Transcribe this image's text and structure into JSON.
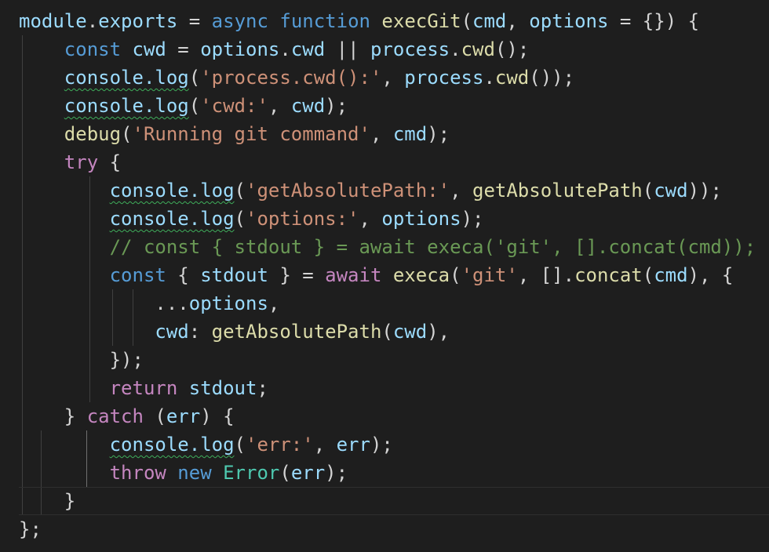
{
  "editor": {
    "language": "javascript",
    "theme": "dark",
    "lines": [
      [
        {
          "t": "module",
          "c": "var"
        },
        {
          "t": ".",
          "c": "pun"
        },
        {
          "t": "exports",
          "c": "var"
        },
        {
          "t": " = ",
          "c": "pun"
        },
        {
          "t": "async",
          "c": "kw"
        },
        {
          "t": " ",
          "c": "pun"
        },
        {
          "t": "function",
          "c": "kw"
        },
        {
          "t": " ",
          "c": "pun"
        },
        {
          "t": "execGit",
          "c": "fn"
        },
        {
          "t": "(",
          "c": "pun"
        },
        {
          "t": "cmd",
          "c": "var"
        },
        {
          "t": ", ",
          "c": "pun"
        },
        {
          "t": "options",
          "c": "var"
        },
        {
          "t": " = {}) {",
          "c": "pun"
        }
      ],
      [
        {
          "t": "    ",
          "c": "pun"
        },
        {
          "t": "const",
          "c": "kw"
        },
        {
          "t": " ",
          "c": "pun"
        },
        {
          "t": "cwd",
          "c": "var"
        },
        {
          "t": " = ",
          "c": "pun"
        },
        {
          "t": "options",
          "c": "var"
        },
        {
          "t": ".",
          "c": "pun"
        },
        {
          "t": "cwd",
          "c": "var"
        },
        {
          "t": " || ",
          "c": "pun"
        },
        {
          "t": "process",
          "c": "var"
        },
        {
          "t": ".",
          "c": "pun"
        },
        {
          "t": "cwd",
          "c": "fn"
        },
        {
          "t": "();",
          "c": "pun"
        }
      ],
      [
        {
          "t": "    ",
          "c": "pun"
        },
        {
          "t": "console.log",
          "c": "var",
          "warn": true
        },
        {
          "t": "(",
          "c": "pun"
        },
        {
          "t": "'process.cwd():'",
          "c": "str"
        },
        {
          "t": ", ",
          "c": "pun"
        },
        {
          "t": "process",
          "c": "var"
        },
        {
          "t": ".",
          "c": "pun"
        },
        {
          "t": "cwd",
          "c": "fn"
        },
        {
          "t": "());",
          "c": "pun"
        }
      ],
      [
        {
          "t": "    ",
          "c": "pun"
        },
        {
          "t": "console.log",
          "c": "var",
          "warn": true
        },
        {
          "t": "(",
          "c": "pun"
        },
        {
          "t": "'cwd:'",
          "c": "str"
        },
        {
          "t": ", ",
          "c": "pun"
        },
        {
          "t": "cwd",
          "c": "var"
        },
        {
          "t": ");",
          "c": "pun"
        }
      ],
      [
        {
          "t": "    ",
          "c": "pun"
        },
        {
          "t": "debug",
          "c": "fn"
        },
        {
          "t": "(",
          "c": "pun"
        },
        {
          "t": "'Running git command'",
          "c": "str"
        },
        {
          "t": ", ",
          "c": "pun"
        },
        {
          "t": "cmd",
          "c": "var"
        },
        {
          "t": ");",
          "c": "pun"
        }
      ],
      [
        {
          "t": "    ",
          "c": "pun"
        },
        {
          "t": "try",
          "c": "ctl"
        },
        {
          "t": " {",
          "c": "pun"
        }
      ],
      [
        {
          "t": "        ",
          "c": "pun"
        },
        {
          "t": "console.log",
          "c": "var",
          "warn": true
        },
        {
          "t": "(",
          "c": "pun"
        },
        {
          "t": "'getAbsolutePath:'",
          "c": "str"
        },
        {
          "t": ", ",
          "c": "pun"
        },
        {
          "t": "getAbsolutePath",
          "c": "fn"
        },
        {
          "t": "(",
          "c": "pun"
        },
        {
          "t": "cwd",
          "c": "var"
        },
        {
          "t": "));",
          "c": "pun"
        }
      ],
      [
        {
          "t": "        ",
          "c": "pun"
        },
        {
          "t": "console.log",
          "c": "var",
          "warn": true
        },
        {
          "t": "(",
          "c": "pun"
        },
        {
          "t": "'options:'",
          "c": "str"
        },
        {
          "t": ", ",
          "c": "pun"
        },
        {
          "t": "options",
          "c": "var"
        },
        {
          "t": ");",
          "c": "pun"
        }
      ],
      [
        {
          "t": "        ",
          "c": "pun"
        },
        {
          "t": "// const { stdout } = await execa('git', [].concat(cmd));",
          "c": "cmt"
        }
      ],
      [
        {
          "t": "        ",
          "c": "pun"
        },
        {
          "t": "const",
          "c": "kw"
        },
        {
          "t": " { ",
          "c": "pun"
        },
        {
          "t": "stdout",
          "c": "var"
        },
        {
          "t": " } = ",
          "c": "pun"
        },
        {
          "t": "await",
          "c": "ctl"
        },
        {
          "t": " ",
          "c": "pun"
        },
        {
          "t": "execa",
          "c": "fn"
        },
        {
          "t": "(",
          "c": "pun"
        },
        {
          "t": "'git'",
          "c": "str"
        },
        {
          "t": ", [].",
          "c": "pun"
        },
        {
          "t": "concat",
          "c": "fn"
        },
        {
          "t": "(",
          "c": "pun"
        },
        {
          "t": "cmd",
          "c": "var"
        },
        {
          "t": "), {",
          "c": "pun"
        }
      ],
      [
        {
          "t": "            ",
          "c": "pun"
        },
        {
          "t": "...",
          "c": "pun"
        },
        {
          "t": "options",
          "c": "var"
        },
        {
          "t": ",",
          "c": "pun"
        }
      ],
      [
        {
          "t": "            ",
          "c": "pun"
        },
        {
          "t": "cwd",
          "c": "var"
        },
        {
          "t": ": ",
          "c": "pun"
        },
        {
          "t": "getAbsolutePath",
          "c": "fn"
        },
        {
          "t": "(",
          "c": "pun"
        },
        {
          "t": "cwd",
          "c": "var"
        },
        {
          "t": "),",
          "c": "pun"
        }
      ],
      [
        {
          "t": "        ",
          "c": "pun"
        },
        {
          "t": "});",
          "c": "pun"
        }
      ],
      [
        {
          "t": "        ",
          "c": "pun"
        },
        {
          "t": "return",
          "c": "ctl"
        },
        {
          "t": " ",
          "c": "pun"
        },
        {
          "t": "stdout",
          "c": "var"
        },
        {
          "t": ";",
          "c": "pun"
        }
      ],
      [
        {
          "t": "    ",
          "c": "pun"
        },
        {
          "t": "} ",
          "c": "pun"
        },
        {
          "t": "catch",
          "c": "ctl"
        },
        {
          "t": " (",
          "c": "pun"
        },
        {
          "t": "err",
          "c": "var"
        },
        {
          "t": ") {",
          "c": "pun"
        }
      ],
      [
        {
          "t": "        ",
          "c": "pun"
        },
        {
          "t": "console.log",
          "c": "var",
          "warn": true
        },
        {
          "t": "(",
          "c": "pun"
        },
        {
          "t": "'err:'",
          "c": "str"
        },
        {
          "t": ", ",
          "c": "pun"
        },
        {
          "t": "err",
          "c": "var"
        },
        {
          "t": ");",
          "c": "pun"
        }
      ],
      [
        {
          "t": "        ",
          "c": "pun"
        },
        {
          "t": "throw",
          "c": "ctl"
        },
        {
          "t": " ",
          "c": "pun"
        },
        {
          "t": "new",
          "c": "kw"
        },
        {
          "t": " ",
          "c": "pun"
        },
        {
          "t": "Error",
          "c": "cls"
        },
        {
          "t": "(",
          "c": "pun"
        },
        {
          "t": "err",
          "c": "var"
        },
        {
          "t": ");",
          "c": "pun"
        }
      ],
      [
        {
          "t": "    ",
          "c": "pun"
        },
        {
          "t": "}",
          "c": "pun"
        }
      ],
      [
        {
          "t": "};",
          "c": "pun"
        }
      ]
    ],
    "current_line": 17
  },
  "colors": {
    "background": "#1e1e1e",
    "keyword": "#569cd6",
    "control": "#c586c0",
    "function": "#dcdcaa",
    "variable": "#9cdcfe",
    "string": "#ce9178",
    "class": "#4ec9b0",
    "comment": "#6a9955",
    "punctuation": "#d4d4d4",
    "warning_squiggle": "#3fae5b"
  }
}
